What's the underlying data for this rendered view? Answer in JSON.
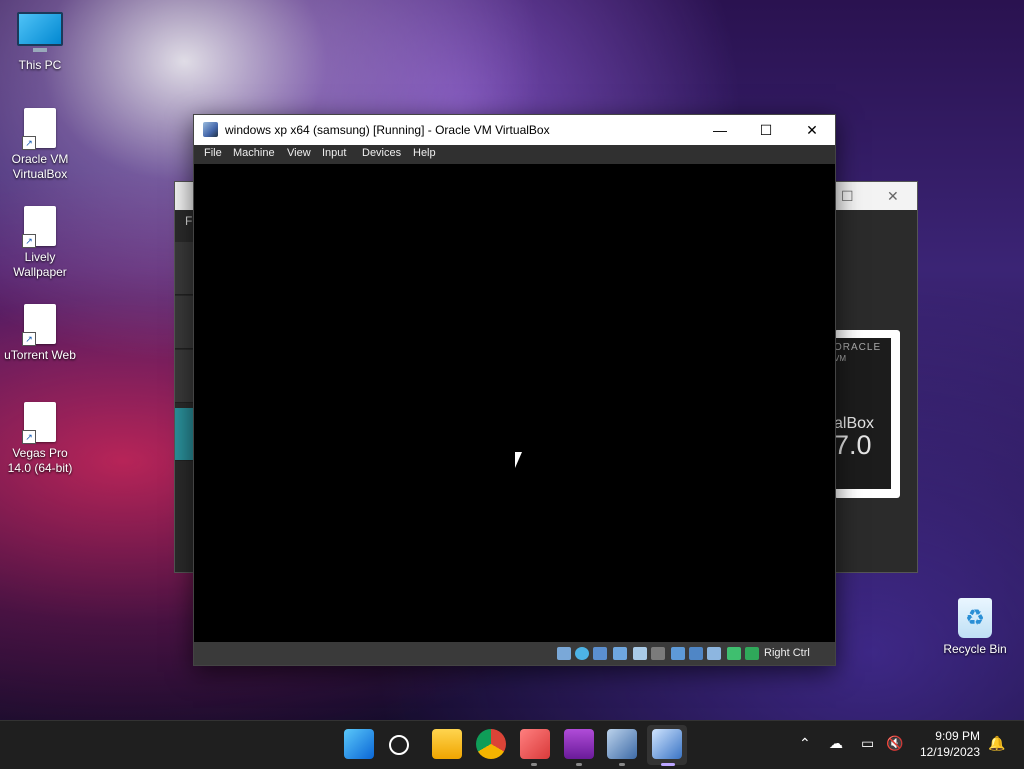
{
  "desktop": {
    "icons": [
      {
        "label": "This PC",
        "icon": "monitor-icon"
      },
      {
        "label": "Oracle VM VirtualBox",
        "icon": "shortcut-icon"
      },
      {
        "label": "Lively Wallpaper",
        "icon": "shortcut-icon"
      },
      {
        "label": "uTorrent Web",
        "icon": "shortcut-icon"
      },
      {
        "label": "Vegas Pro 14.0 (64-bit)",
        "icon": "shortcut-icon"
      },
      {
        "label": "Recycle Bin",
        "icon": "recycle-bin-icon"
      }
    ]
  },
  "background_window": {
    "menu_partial": "Fil",
    "about": {
      "brand": "ORACLE",
      "vm": "VM",
      "product": "alBox",
      "version": "7.0"
    }
  },
  "vm_window": {
    "title": "windows xp x64 (samsung) [Running] - Oracle VM VirtualBox",
    "controls": {
      "minimize": "—",
      "maximize": "☐",
      "close": "✕"
    },
    "menu": [
      "File",
      "Machine",
      "View",
      "Input",
      "Devices",
      "Help"
    ],
    "status_icons": [
      "hard-disk-icon",
      "optical-drive-icon",
      "audio-icon",
      "network-icon",
      "usb-icon",
      "shared-folders-icon",
      "display-icon",
      "video-capture-icon",
      "cpu-icon",
      "mouse-integration-icon",
      "keyboard-icon"
    ],
    "host_key": "Right Ctrl"
  },
  "taskbar": {
    "apps": [
      "start-icon",
      "search-icon",
      "file-explorer-icon",
      "chrome-icon",
      "snipping-tool-icon",
      "winrar-icon",
      "virtualbox-icon",
      "windows-xp-vm-icon"
    ],
    "clock": {
      "time": "9:09 PM",
      "date": "12/19/2023"
    }
  }
}
